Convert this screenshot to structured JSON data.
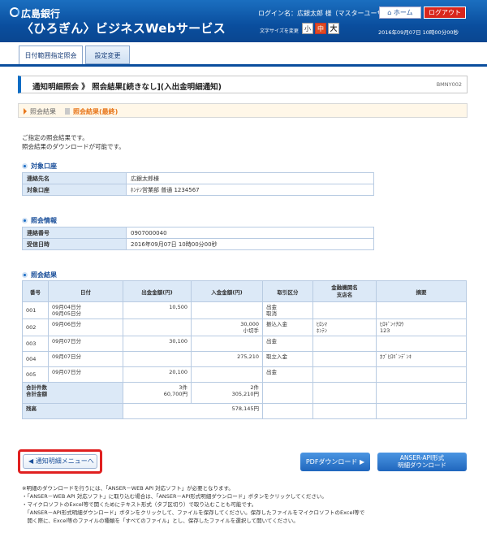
{
  "header": {
    "bank_name": "広島銀行",
    "service_name": "〈ひろぎん〉ビジネスWebサービス",
    "login_name": "ログイン名：広銀太郎 様（マスターユーザ）",
    "font_size_label": "文字サイズを変更",
    "font_sizes": [
      "小",
      "中",
      "大"
    ],
    "home_label": "ホーム",
    "logout_label": "ログアウト",
    "datetime": "2016年09月07日 10時00分00秒"
  },
  "nav": {
    "tabs": [
      {
        "label": "日付範囲指定照会"
      },
      {
        "label": "設定変更"
      }
    ]
  },
  "page": {
    "title": "通知明細照会 》 照会結果[続きなし](入出金明細通知)",
    "code": "BMNY002",
    "steps": [
      "照会結果",
      "照会結果(最終)"
    ],
    "intro_line1": "ご指定の照会結果です。",
    "intro_line2": "照会結果のダウンロードが可能です。"
  },
  "target_account": {
    "heading": "対象口座",
    "rows": [
      {
        "label": "連絡先名",
        "value": "広銀太郎様"
      },
      {
        "label": "対象口座",
        "value": "ﾎﾝﾃﾝ営業部 普通 1234567"
      }
    ]
  },
  "inquiry_info": {
    "heading": "照会情報",
    "rows": [
      {
        "label": "連絡番号",
        "value": "0907000040"
      },
      {
        "label": "受信日時",
        "value": "2016年09月07日 10時00分00秒"
      }
    ]
  },
  "results": {
    "heading": "照会結果",
    "columns": [
      "番号",
      "日付",
      "出金金額(円)",
      "入金金額(円)",
      "取引区分",
      "金融機関名\n支店名",
      "摘要"
    ],
    "rows": [
      {
        "no": "001",
        "date": "09月04日分\n09月05日分",
        "out": "10,500",
        "in": "",
        "type": "出金\n取消",
        "bank": "",
        "memo": ""
      },
      {
        "no": "002",
        "date": "09月06日分",
        "out": "",
        "in": "30,000\n小切手",
        "type": "振込入金",
        "bank": "ﾋﾛｼﾏ\nﾎﾝﾃﾝ",
        "memo": "ﾋﾛｷﾞﾝｲﾁﾛｳ\n123"
      },
      {
        "no": "003",
        "date": "09月07日分",
        "out": "30,100",
        "in": "",
        "type": "出金",
        "bank": "",
        "memo": ""
      },
      {
        "no": "004",
        "date": "09月07日分",
        "out": "",
        "in": "275,210",
        "type": "取立入金",
        "bank": "",
        "memo": "ｶﾌﾞﾋﾛｷﾞﾝﾃﾞﾝｷ"
      },
      {
        "no": "005",
        "date": "09月07日分",
        "out": "20,100",
        "in": "",
        "type": "出金",
        "bank": "",
        "memo": ""
      }
    ],
    "total_label": "合計件数\n合計金額",
    "total_out": "3件\n60,700円",
    "total_in": "2件\n305,210円",
    "balance_label": "残高",
    "balance_value": "578,145円"
  },
  "actions": {
    "back_label": "通知明細メニューへ",
    "pdf_label": "PDFダウンロード",
    "anser_label_1": "ANSER-API形式",
    "anser_label_2": "明細ダウンロード"
  },
  "notes": [
    "※明細のダウンロードを行うには、「ANSER－WEB API 対応ソフト」が必要となります。",
    "・「ANSER－WEB API 対応ソフト」に取り込む場合は、「ANSER－API形式明細ダウンロード」ボタンをクリックしてください。",
    "・マイクロソフトのExcel等で開くためにテキスト形式（タブ区切り）で取り込むことも可能です。",
    "　「ANSER－API形式明細ダウンロード」ボタンをクリックして、ファイルを保存してください。保存したファイルをマイクロソフトのExcel等で",
    "　開く際に、Excel等のファイルの種類を「すべてのファイル」とし、保存したファイルを選択して開いてください。"
  ],
  "colors": {
    "header": "#0a4e9e",
    "accent": "#e8771b",
    "table_head": "#dce9f7",
    "highlight": "#e02020"
  }
}
